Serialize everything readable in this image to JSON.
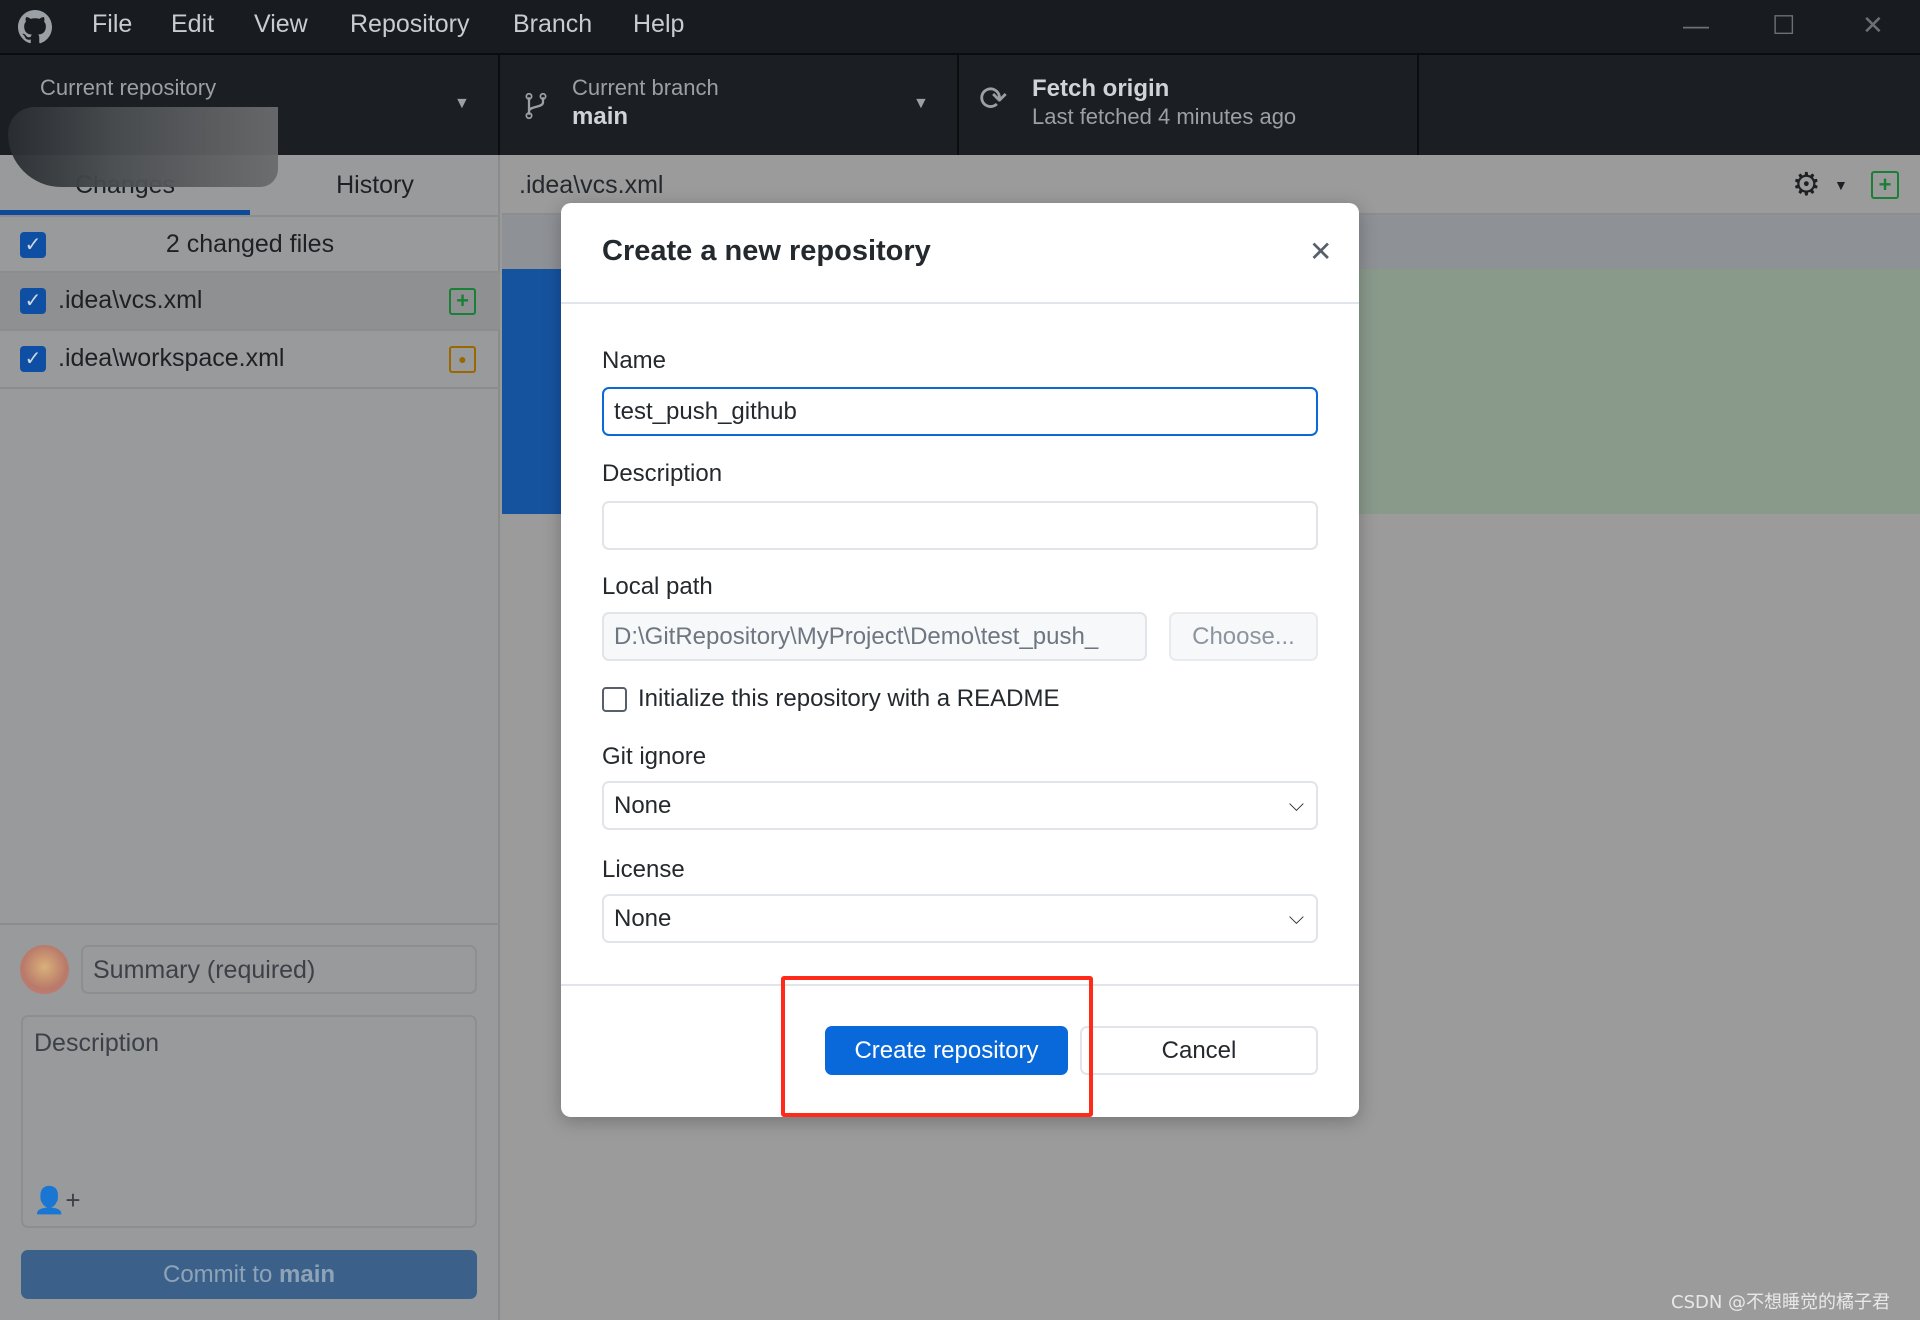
{
  "menu": {
    "items": [
      "File",
      "Edit",
      "View",
      "Repository",
      "Branch",
      "Help"
    ]
  },
  "window_controls": {
    "minimize": "—",
    "maximize": "☐",
    "close": "✕"
  },
  "toolbar": {
    "repository": {
      "label": "Current repository"
    },
    "branch": {
      "label": "Current branch",
      "value": "main"
    },
    "fetch": {
      "label": "Fetch origin",
      "status": "Last fetched 4 minutes ago"
    }
  },
  "sidebar": {
    "tabs": [
      {
        "label": "Changes",
        "active": true
      },
      {
        "label": "History",
        "active": false
      }
    ],
    "changed_count": "2 changed files",
    "files": [
      {
        "name": ".idea\\vcs.xml",
        "status": "added",
        "color": "#1a7f37"
      },
      {
        "name": ".idea\\workspace.xml",
        "status": "modified",
        "color": "#9a6700"
      }
    ],
    "summary_placeholder": "Summary (required)",
    "description_placeholder": "Description",
    "commit_label_prefix": "Commit to ",
    "commit_branch": "main"
  },
  "diff": {
    "file": ".idea\\vcs.xml"
  },
  "dialog": {
    "title": "Create a new repository",
    "name_label": "Name",
    "name_value": "test_push_github",
    "description_label": "Description",
    "description_value": "",
    "local_path_label": "Local path",
    "local_path_value": "D:\\GitRepository\\MyProject\\Demo\\test_push_",
    "choose_label": "Choose...",
    "readme_label": "Initialize this repository with a README",
    "readme_checked": false,
    "gitignore_label": "Git ignore",
    "gitignore_value": "None",
    "license_label": "License",
    "license_value": "None",
    "create_label": "Create repository",
    "cancel_label": "Cancel"
  },
  "colors": {
    "accent": "#0969da",
    "highlight": "#ff2a1a"
  },
  "watermark": "CSDN @不想睡觉的橘子君"
}
